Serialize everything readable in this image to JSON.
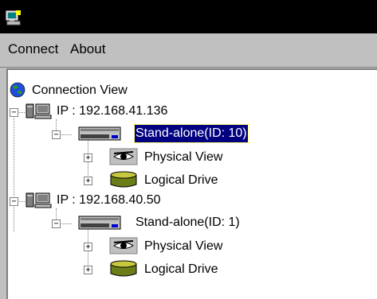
{
  "menu": {
    "connect": "Connect",
    "about": "About"
  },
  "tree": {
    "root": "Connection View",
    "hosts": [
      {
        "ip": "IP : 192.168.41.136",
        "controller": "Stand-alone(ID: 10)",
        "children": [
          "Physical View",
          "Logical Drive"
        ]
      },
      {
        "ip": "IP : 192.168.40.50",
        "controller": "Stand-alone(ID: 1)",
        "children": [
          "Physical View",
          "Logical Drive"
        ]
      }
    ]
  },
  "colors": {
    "selection": "#000080",
    "titlebar": "#000000",
    "chrome": "#c0c0c0"
  }
}
